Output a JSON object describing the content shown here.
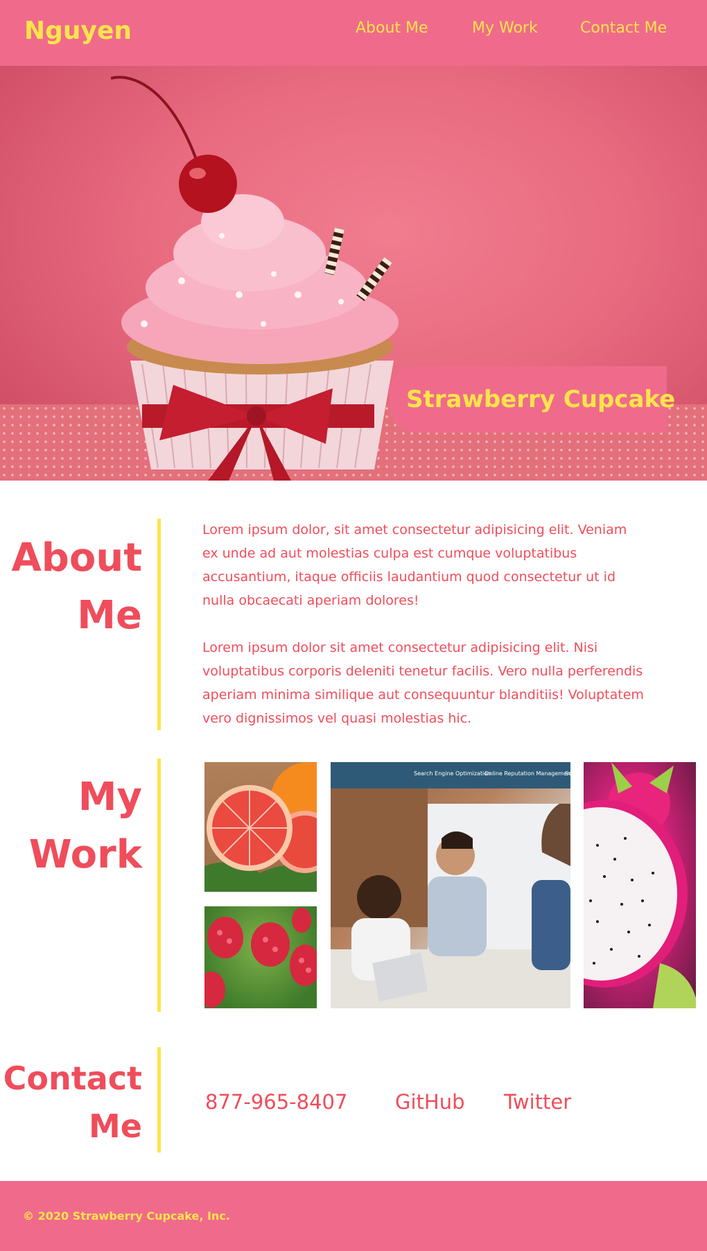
{
  "header": {
    "brand": "Nguyen",
    "nav": [
      "About Me",
      "My Work",
      "Contact Me"
    ]
  },
  "hero": {
    "title": "Strawberry Cupcake",
    "image": "cupcake-photo"
  },
  "about": {
    "heading_line1": "About",
    "heading_line2": "Me",
    "paragraphs": [
      "Lorem ipsum dolor, sit amet consectetur adipisicing elit. Veniam ex unde ad aut molestias culpa est cumque voluptatibus accusantium, itaque officiis laudantium quod consectetur ut id nulla obcaecati aperiam dolores!",
      "Lorem ipsum dolor sit amet consectetur adipisicing elit. Nisi voluptatibus corporis deleniti tenetur facilis. Vero nulla perferendis aperiam minima similique aut consequuntur blanditiis! Voluptatem vero dignissimos vel quasi molestias hic."
    ]
  },
  "work": {
    "heading_line1": "My",
    "heading_line2": "Work",
    "tiles": [
      "grapefruit-photo",
      "raspberry-photo",
      "office-meeting-photo",
      "dragonfruit-photo"
    ],
    "office_nav": [
      "Search Engine Optimization",
      "Online Reputation Management",
      "So"
    ]
  },
  "contact": {
    "heading_line1": "Contact",
    "heading_line2": "Me",
    "phone": "877-965-8407",
    "github": "GitHub",
    "twitter": "Twitter"
  },
  "footer": {
    "copyright": "© 2020 Strawberry Cupcake, Inc."
  },
  "colors": {
    "pink": "#f06b8b",
    "yellow": "#fde44b",
    "coral": "#ef4d5b",
    "white": "#ffffff"
  }
}
